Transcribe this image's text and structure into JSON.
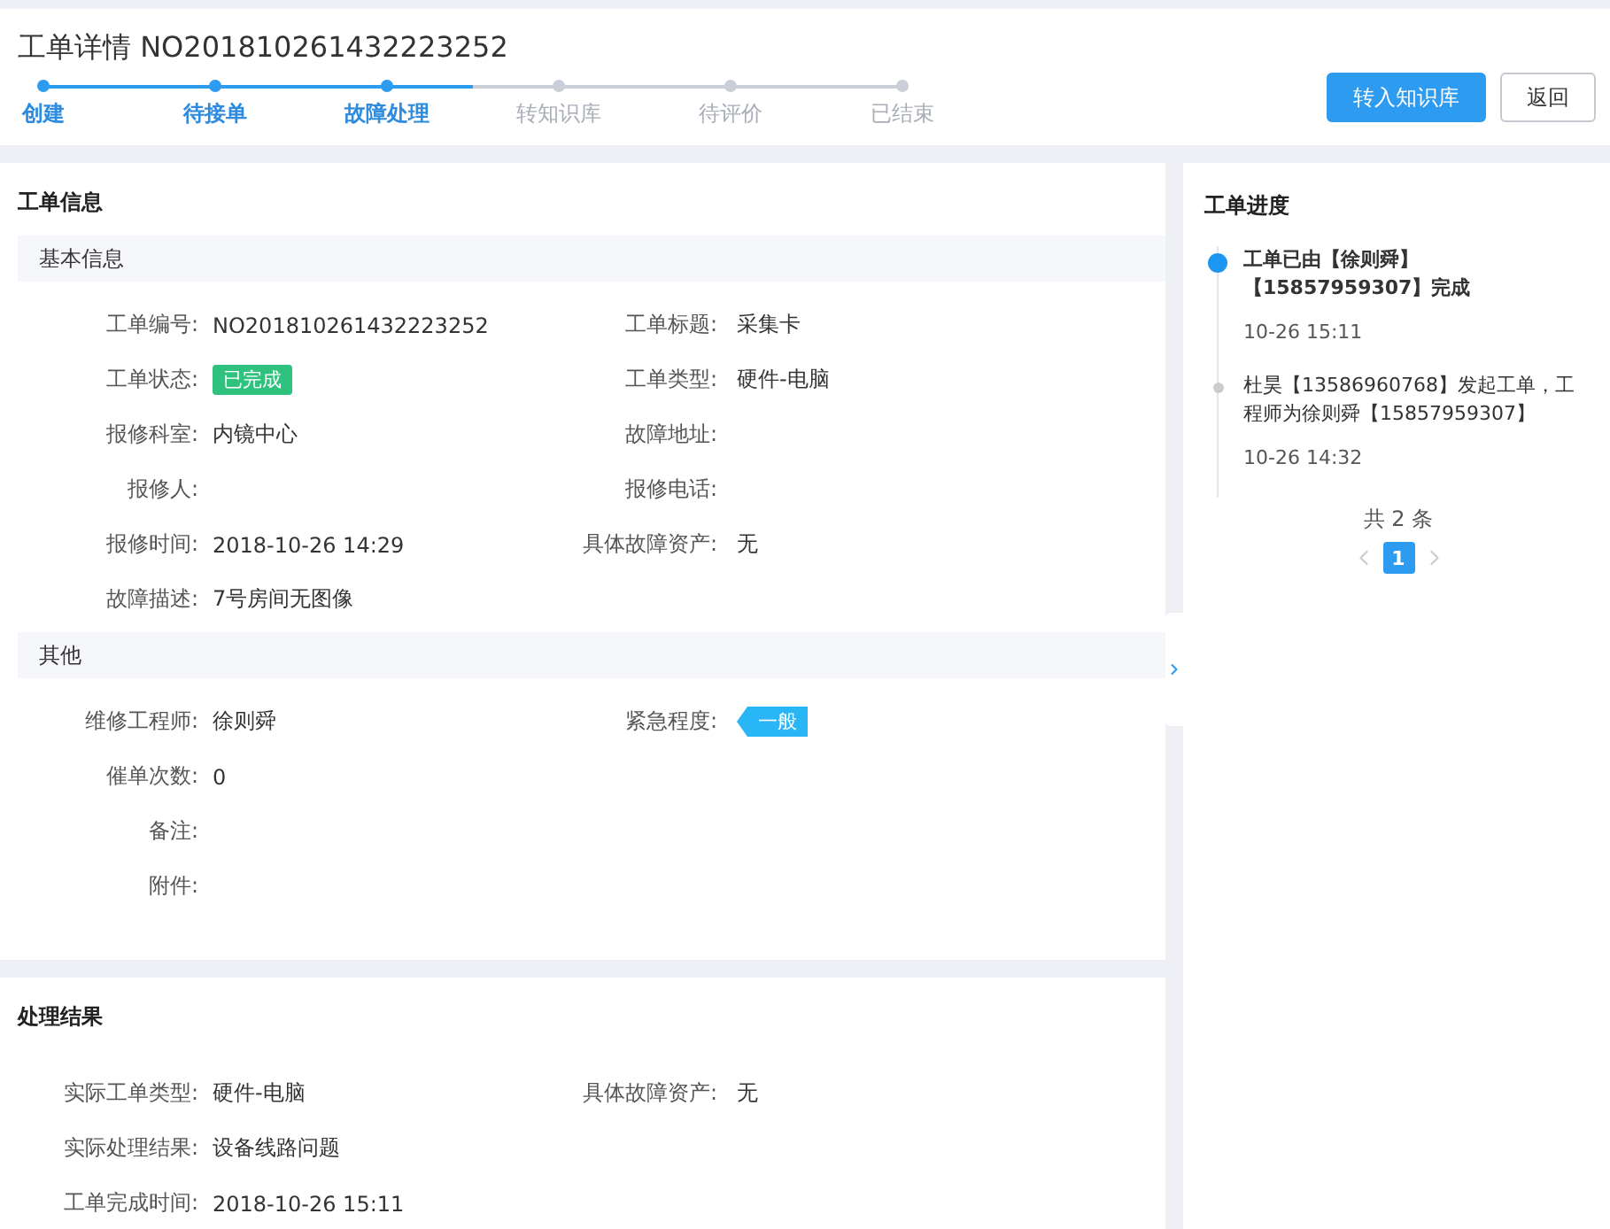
{
  "header": {
    "title": "工单详情 NO201810261432223252",
    "steps": [
      {
        "label": "创建",
        "done": true
      },
      {
        "label": "待接单",
        "done": true
      },
      {
        "label": "故障处理",
        "done": true
      },
      {
        "label": "转知识库",
        "done": false
      },
      {
        "label": "待评价",
        "done": false
      },
      {
        "label": "已结束",
        "done": false
      }
    ],
    "buttons": [
      {
        "label": "转入知识库",
        "kind": "primary"
      },
      {
        "label": "返回",
        "kind": "default"
      }
    ]
  },
  "cards": [
    {
      "title": "工单信息",
      "groups": [
        {
          "title": "基本信息",
          "rows": [
            [
              {
                "label": "工单编号:",
                "value": "NO201810261432223252",
                "kind": "text"
              },
              {
                "label": "工单标题:",
                "value": "采集卡",
                "kind": "text"
              }
            ],
            [
              {
                "label": "工单状态:",
                "value": "已完成",
                "kind": "status"
              },
              {
                "label": "工单类型:",
                "value": "硬件-电脑",
                "kind": "text"
              }
            ],
            [
              {
                "label": "报修科室:",
                "value": "内镜中心",
                "kind": "text"
              },
              {
                "label": "故障地址:"
              }
            ],
            [
              {
                "label": "报修人:"
              },
              {
                "label": "报修电话:"
              }
            ],
            [
              {
                "label": "报修时间:",
                "value": "2018-10-26 14:29",
                "kind": "text"
              },
              {
                "label": "具体故障资产:",
                "value": "无",
                "kind": "text"
              }
            ],
            [
              {
                "label": "故障描述:",
                "value": "7号房间无图像",
                "kind": "text"
              }
            ]
          ]
        },
        {
          "title": "其他",
          "rows": [
            [
              {
                "label": "维修工程师:",
                "value": "徐则舜",
                "kind": "text"
              },
              {
                "label": "紧急程度:",
                "value": "一般",
                "kind": "priority"
              }
            ],
            [
              {
                "label": "催单次数:",
                "value": "0",
                "kind": "text"
              }
            ],
            [
              {
                "label": "备注:"
              }
            ],
            [
              {
                "label": "附件:"
              }
            ]
          ]
        }
      ]
    },
    {
      "title": "处理结果",
      "groups": [
        {
          "rows": [
            [
              {
                "label": "实际工单类型:",
                "value": "硬件-电脑",
                "kind": "text"
              },
              {
                "label": "具体故障资产:",
                "value": "无",
                "kind": "text"
              }
            ],
            [
              {
                "label": "实际处理结果:",
                "value": "设备线路问题",
                "kind": "text"
              }
            ],
            [
              {
                "label": "工单完成时间:",
                "value": "2018-10-26 15:11",
                "kind": "text"
              }
            ]
          ]
        }
      ]
    }
  ],
  "progress": {
    "title": "工单进度",
    "items": [
      {
        "text": "工单已由【徐则舜】【15857959307】完成",
        "time": "10-26 15:11",
        "active": true
      },
      {
        "text": "杜昊【13586960768】发起工单，工程师为徐则舜【15857959307】",
        "time": "10-26 14:32",
        "active": false
      }
    ],
    "total": "共 2 条",
    "pages": [
      {
        "label": "1",
        "selected": true
      }
    ]
  }
}
